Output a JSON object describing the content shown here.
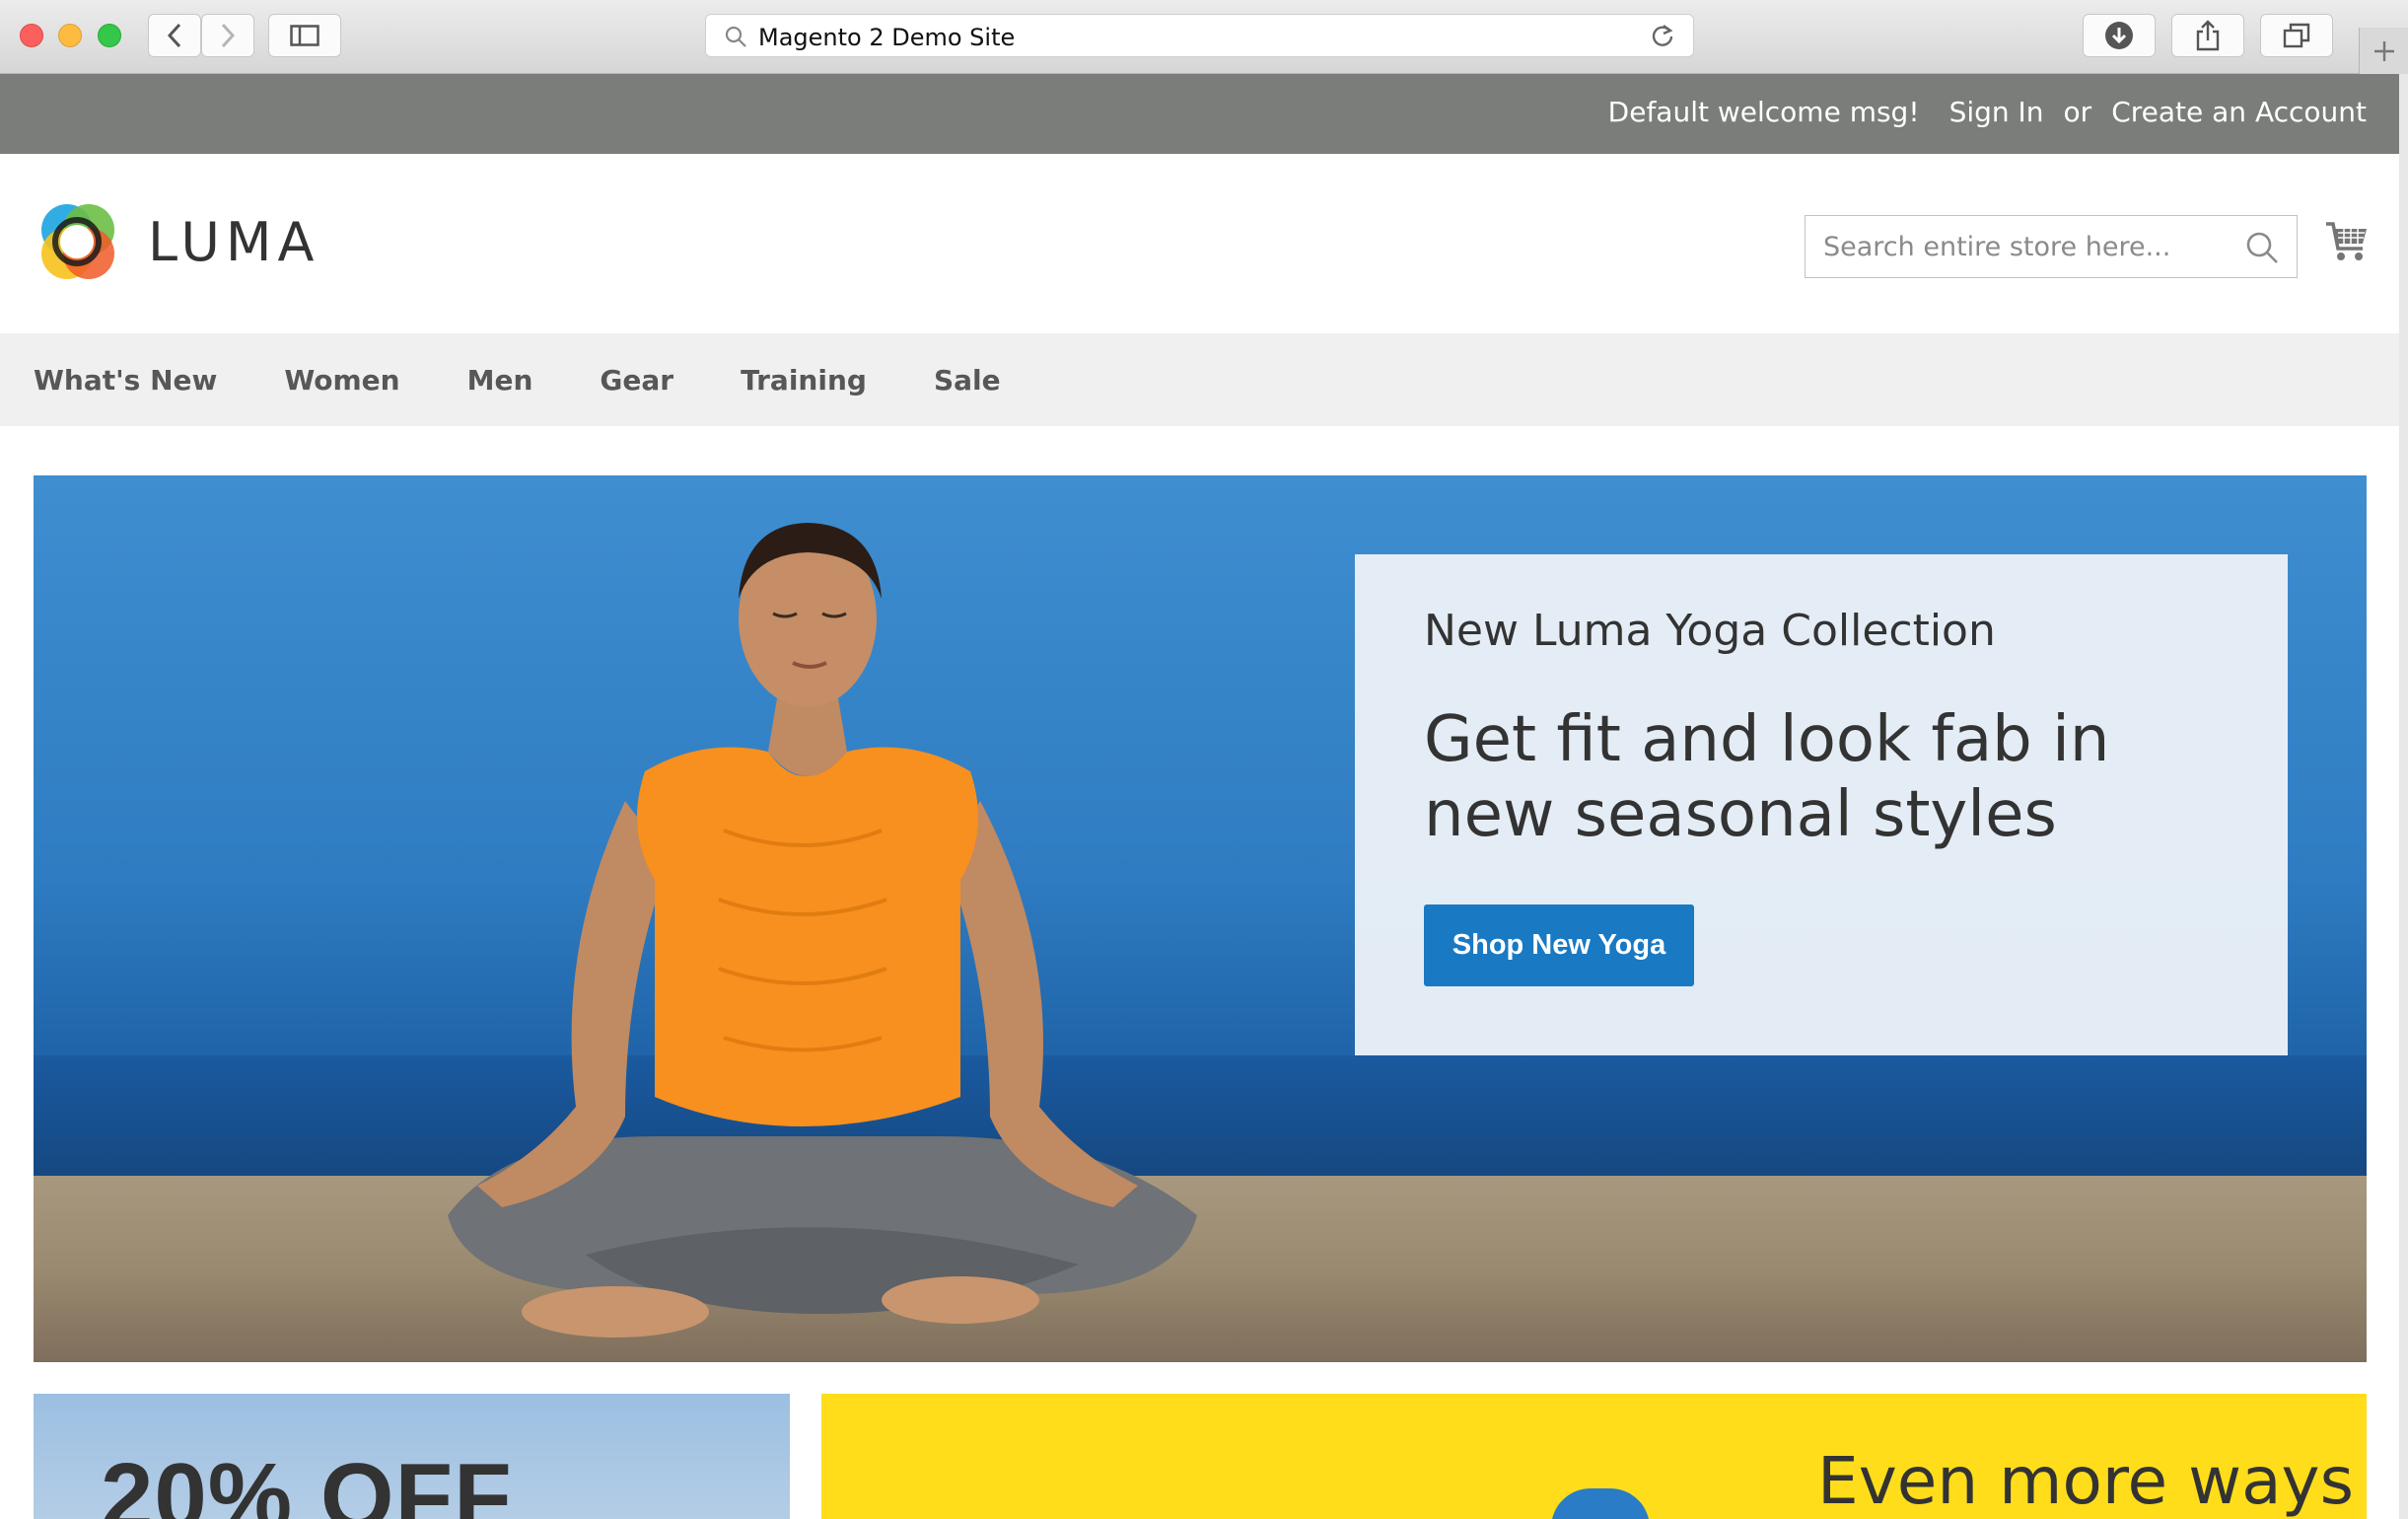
{
  "browser": {
    "url": "Magento 2 Demo Site"
  },
  "panel": {
    "welcome": "Default welcome msg!",
    "sign_in": "Sign In",
    "or": "or",
    "create_account": "Create an Account"
  },
  "header": {
    "logo_text": "LUMA",
    "search_placeholder": "Search entire store here..."
  },
  "nav": {
    "items": [
      "What's New",
      "Women",
      "Men",
      "Gear",
      "Training",
      "Sale"
    ]
  },
  "hero": {
    "promo_title": "New Luma Yoga Collection",
    "promo_headline": "Get fit and look fab in new seasonal styles",
    "promo_button": "Shop New Yoga"
  },
  "tiles": {
    "left_text": "20% OFF",
    "right_text": "Even more ways"
  },
  "colors": {
    "panel_bg": "#7b7d7b",
    "nav_bg": "#f0f0f0",
    "primary_button": "#1979c3",
    "promo_yellow": "#ffdd1a",
    "text_dark": "#333333"
  },
  "icons": {
    "search": "search-icon",
    "cart": "cart-icon",
    "back": "chevron-left-icon",
    "forward": "chevron-right-icon",
    "sidebar": "sidebar-icon",
    "download": "download-icon",
    "share": "share-icon",
    "tabs": "tabs-icon",
    "reload": "reload-icon",
    "new_tab": "plus-icon"
  }
}
